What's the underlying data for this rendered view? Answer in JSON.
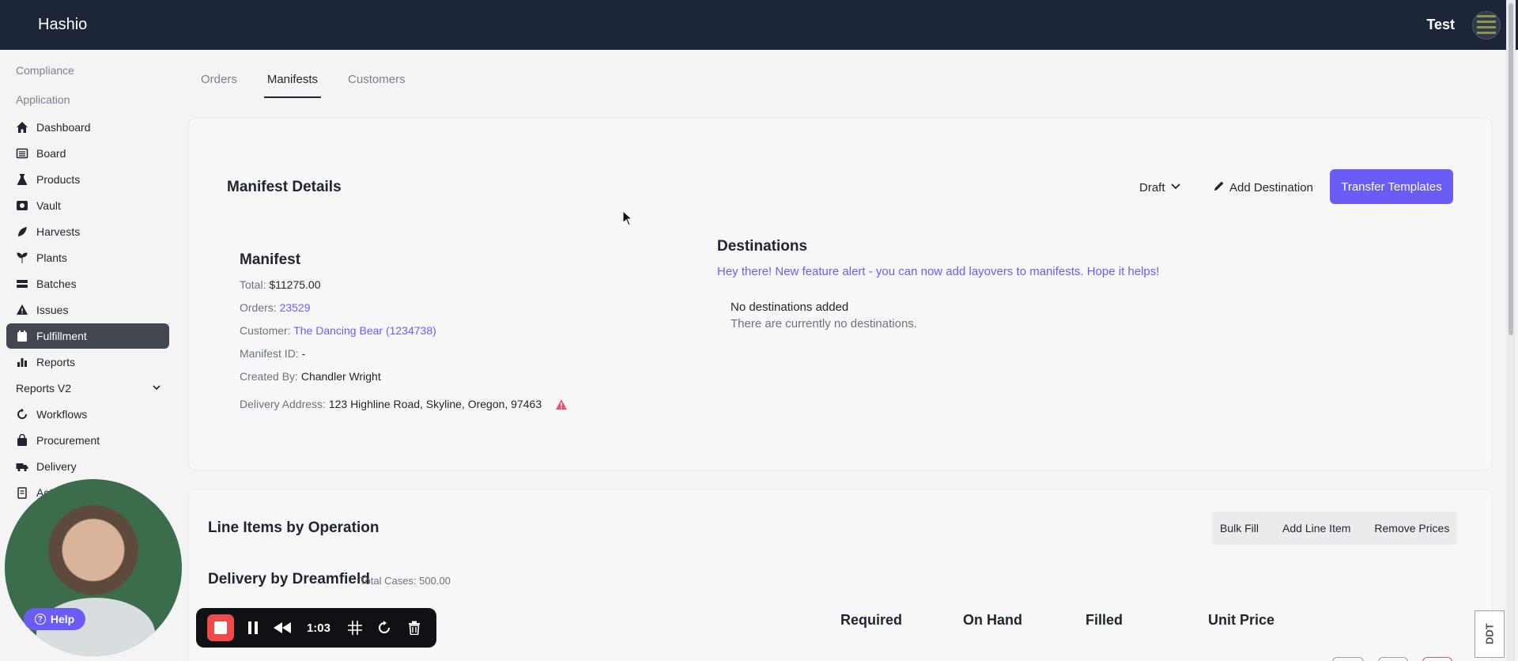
{
  "app": {
    "brand": "Hashio",
    "user_name": "Test"
  },
  "sidebar": {
    "sections": [
      "Compliance",
      "Application"
    ],
    "items": [
      {
        "label": "Dashboard",
        "icon": "home-icon"
      },
      {
        "label": "Board",
        "icon": "board-icon"
      },
      {
        "label": "Products",
        "icon": "flask-icon"
      },
      {
        "label": "Vault",
        "icon": "vault-icon"
      },
      {
        "label": "Harvests",
        "icon": "leaf-icon"
      },
      {
        "label": "Plants",
        "icon": "plant-icon"
      },
      {
        "label": "Batches",
        "icon": "layers-icon"
      },
      {
        "label": "Issues",
        "icon": "warning-icon"
      },
      {
        "label": "Fulfillment",
        "icon": "calendar-icon",
        "active": true
      },
      {
        "label": "Reports",
        "icon": "bar-chart-icon"
      },
      {
        "label": "Reports V2",
        "icon": "chevron-down-icon"
      },
      {
        "label": "Workflows",
        "icon": "cycle-icon"
      },
      {
        "label": "Procurement",
        "icon": "bag-icon"
      },
      {
        "label": "Delivery",
        "icon": "truck-icon"
      },
      {
        "label": "Acti",
        "icon": "clipboard-icon"
      }
    ]
  },
  "tabs": [
    {
      "label": "Orders",
      "active": false
    },
    {
      "label": "Manifests",
      "active": true
    },
    {
      "label": "Customers",
      "active": false
    }
  ],
  "manifest_details": {
    "title": "Manifest Details",
    "status": "Draft",
    "add_destination": "Add Destination",
    "transfer_templates": "Transfer Templates",
    "manifest": {
      "heading": "Manifest",
      "total_label": "Total:",
      "total_value": "$11275.00",
      "orders_label": "Orders:",
      "orders_value": "23529",
      "customer_label": "Customer:",
      "customer_value": "The Dancing Bear (1234738)",
      "manifest_id_label": "Manifest ID:",
      "manifest_id_value": "-",
      "created_by_label": "Created By:",
      "created_by_value": "Chandler Wright",
      "delivery_address_label": "Delivery Address:",
      "delivery_address_value": "123 Highline Road, Skyline, Oregon, 97463"
    },
    "destinations": {
      "heading": "Destinations",
      "alert": "Hey there! New feature alert - you can now add layovers to manifests. Hope it helps!",
      "empty_title": "No destinations added",
      "empty_subtitle": "There are currently no destinations."
    }
  },
  "line_items": {
    "title": "Line Items by Operation",
    "actions": {
      "bulk_fill": "Bulk Fill",
      "add_line_item": "Add Line Item",
      "remove_prices": "Remove Prices"
    },
    "operation_title": "Delivery by Dreamfield",
    "operation_sub": "Total Cases: 500.00",
    "columns": [
      "Required",
      "On Hand",
      "Filled",
      "Unit Price"
    ]
  },
  "overlay": {
    "help": "Help",
    "recorder_time": "1:03",
    "watermark": "DDT"
  },
  "colors": {
    "topbar": "#1c2638",
    "accent": "#6b5cf6",
    "active_nav": "#434750",
    "record": "#ef4a4a"
  }
}
